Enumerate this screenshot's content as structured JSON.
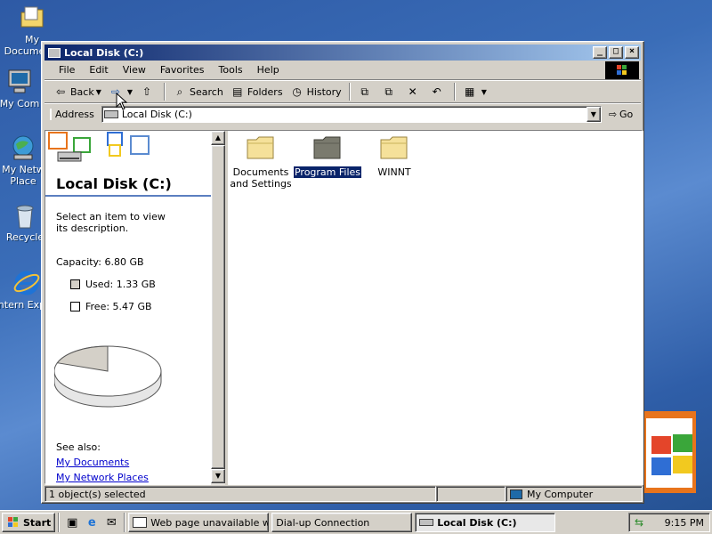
{
  "desktop": {
    "icons": [
      {
        "label": "My Documents",
        "icon": "folder-documents-icon"
      },
      {
        "label": "My Com",
        "icon": "computer-icon"
      },
      {
        "label": "My Netw Place",
        "icon": "network-places-icon"
      },
      {
        "label": "Recycle",
        "icon": "recycle-bin-icon"
      },
      {
        "label": "Intern Explor",
        "icon": "internet-explorer-icon"
      }
    ]
  },
  "window": {
    "title": "Local Disk (C:)",
    "menu": [
      "File",
      "Edit",
      "View",
      "Favorites",
      "Tools",
      "Help"
    ],
    "toolbar": {
      "back": "Back",
      "search": "Search",
      "folders": "Folders",
      "history": "History"
    },
    "address": {
      "label": "Address",
      "value": "Local Disk (C:)",
      "go": "Go"
    },
    "left_pane": {
      "title": "Local Disk (C:)",
      "description": "Select an item to view its description.",
      "capacity": "Capacity: 6.80 GB",
      "used": "Used: 1.33 GB",
      "free": "Free: 5.47 GB",
      "used_fraction": 0.196,
      "see_also": "See also:",
      "links": [
        "My Documents",
        "My Network Places"
      ]
    },
    "folders": [
      {
        "name": "Documents and Settings",
        "selected": false,
        "color": "#f5e19a"
      },
      {
        "name": "Program Files",
        "selected": true,
        "color": "#7a7a6e"
      },
      {
        "name": "WINNT",
        "selected": false,
        "color": "#f5e19a"
      }
    ],
    "status": {
      "selected": "1 object(s) selected",
      "zone": "My Computer"
    }
  },
  "taskbar": {
    "start": "Start",
    "tasks": [
      {
        "label": "Web page unavailable wh...",
        "active": false
      },
      {
        "label": "Dial-up Connection",
        "active": false
      },
      {
        "label": "Local Disk (C:)",
        "active": true
      }
    ],
    "clock": "9:15 PM"
  },
  "colors": {
    "title_bar": "#0a246a",
    "desktop": "#3a6db8",
    "selection": "#0a246a"
  }
}
